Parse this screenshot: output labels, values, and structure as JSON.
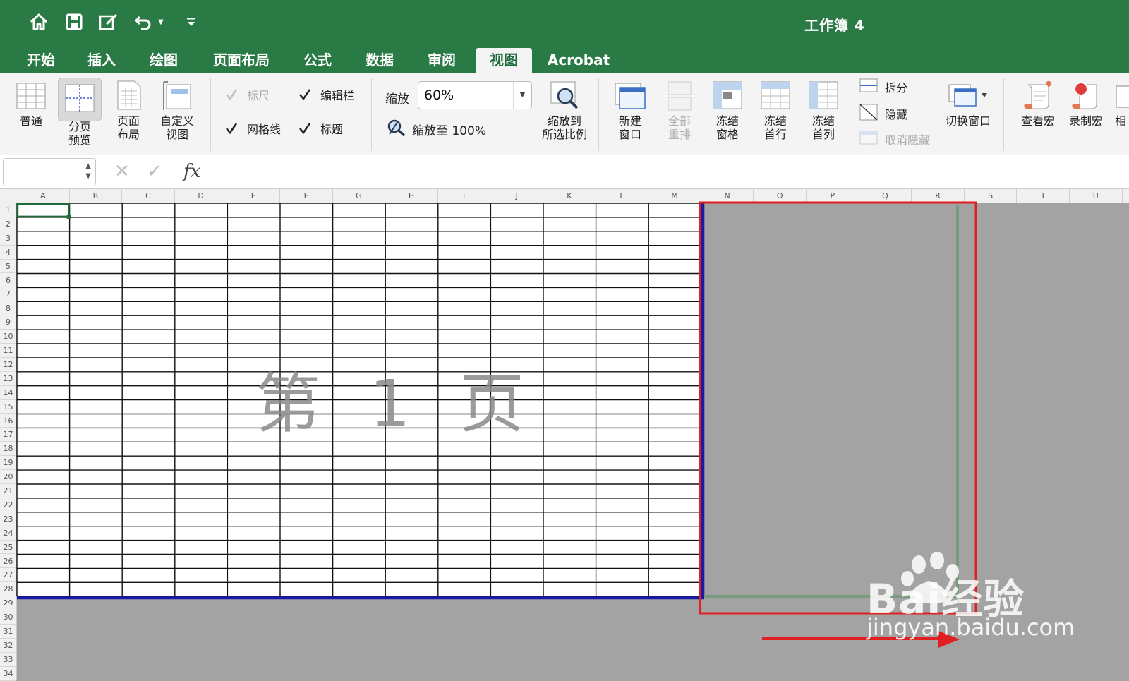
{
  "window": {
    "title": "工作簿 4"
  },
  "tabs": [
    {
      "label": "开始"
    },
    {
      "label": "插入"
    },
    {
      "label": "绘图"
    },
    {
      "label": "页面布局"
    },
    {
      "label": "公式"
    },
    {
      "label": "数据"
    },
    {
      "label": "审阅"
    },
    {
      "label": "视图",
      "active": true
    },
    {
      "label": "Acrobat"
    }
  ],
  "ribbon": {
    "normal": "普通",
    "page_break_1": "分页",
    "page_break_2": "预览",
    "page_layout_1": "页面",
    "page_layout_2": "布局",
    "custom_view_1": "自定义",
    "custom_view_2": "视图",
    "ruler": "标尺",
    "formula_bar": "编辑栏",
    "gridlines": "网格线",
    "headings": "标题",
    "zoom_label": "缩放",
    "zoom_value": "60%",
    "zoom_100": "缩放至 100%",
    "zoom_selection_1": "缩放到",
    "zoom_selection_2": "所选比例",
    "new_window_1": "新建",
    "new_window_2": "窗口",
    "arrange_all_1": "全部",
    "arrange_all_2": "重排",
    "freeze_panes_1": "冻结",
    "freeze_panes_2": "窗格",
    "freeze_top_row_1": "冻结",
    "freeze_top_row_2": "首行",
    "freeze_first_col_1": "冻结",
    "freeze_first_col_2": "首列",
    "split": "拆分",
    "hide": "隐藏",
    "unhide": "取消隐藏",
    "switch_windows": "切换窗口",
    "view_macros": "查看宏",
    "record_macro": "录制宏",
    "relative": "相"
  },
  "columns": [
    "A",
    "B",
    "C",
    "D",
    "E",
    "F",
    "G",
    "H",
    "I",
    "J",
    "K",
    "L",
    "M",
    "N",
    "O",
    "P",
    "Q",
    "R",
    "S",
    "T",
    "U"
  ],
  "rows": [
    "1",
    "2",
    "3",
    "4",
    "5",
    "6",
    "7",
    "8",
    "9",
    "10",
    "11",
    "12",
    "13",
    "14",
    "15",
    "16",
    "17",
    "18",
    "19",
    "20",
    "21",
    "22",
    "23",
    "24",
    "25",
    "26",
    "27",
    "28",
    "29",
    "30",
    "31",
    "32",
    "33",
    "34"
  ],
  "page_watermark": "第 1 页",
  "baidu_logo": "Bai经验",
  "baidu_url": "jingyan.baidu.com",
  "colors": {
    "green": "#2a7a46",
    "page_break_blue": "#1a1aa8",
    "annotation_red": "#e02020"
  }
}
